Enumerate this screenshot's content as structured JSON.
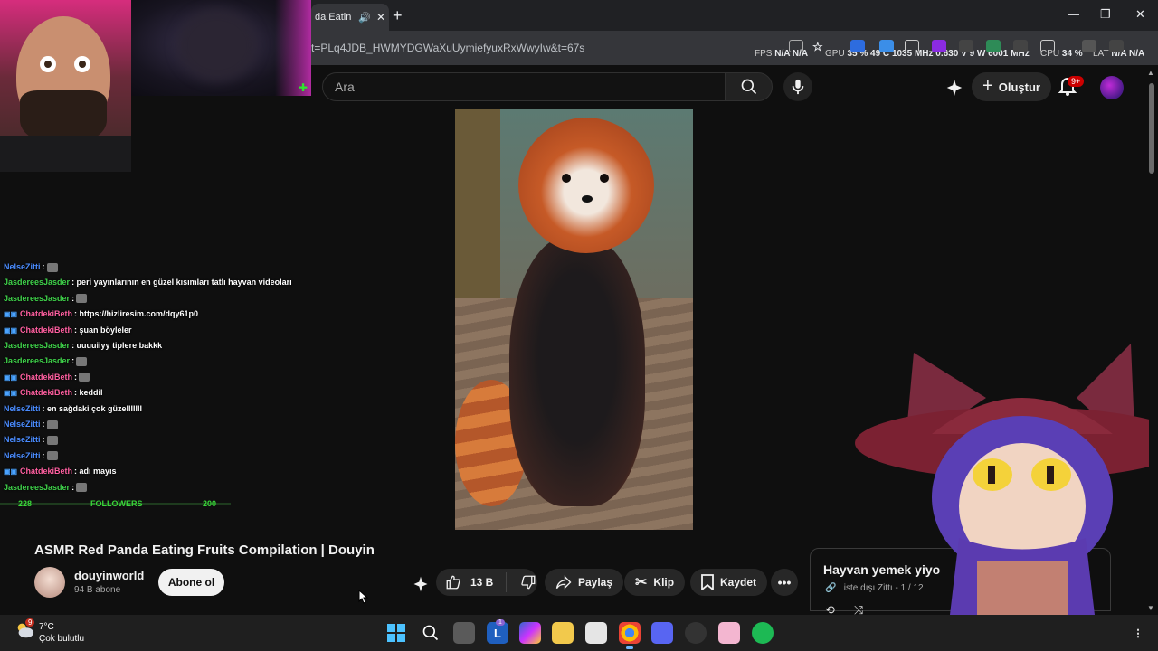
{
  "browser": {
    "tab_title": "da Eatin",
    "url": "t=PLq4JDB_HWMYDGWaXuUymiefyuxRxWwyIw&t=67s"
  },
  "hud": {
    "fps_label": "FPS",
    "fps": "N/A",
    "fps2": "N/A",
    "gpu_label": "GPU",
    "gpu_load": "35 %",
    "gpu_temp": "49 C",
    "gpu_clock": "1035 MHz",
    "gpu_volt": "0.630 V",
    "gpu_power": "9 W",
    "mem_clock": "6001 MHz",
    "cpu_label": "CPU",
    "cpu_load": "34 %",
    "lat_label": "LAT",
    "lat": "N/A",
    "lat2": "N/A"
  },
  "youtube": {
    "search_placeholder": "Ara",
    "create_label": "Oluştur",
    "notifications": "9+"
  },
  "chat": {
    "messages": [
      {
        "user": "NelseZitti",
        "text": ":",
        "color": "#4a8cff",
        "emote": true
      },
      {
        "user": "JasdereesJasder",
        "text": ": peri yayınlarının en güzel kısımları tatlı hayvan videoları",
        "color": "#3fd24a",
        "emote": false
      },
      {
        "user": "JasdereesJasder",
        "text": ":",
        "color": "#3fd24a",
        "emote": true
      },
      {
        "user": "ChatdekiBeth",
        "text": ": https://hizliresim.com/dqy61p0",
        "color": "#ff5fa0",
        "emote": false,
        "badges": true
      },
      {
        "user": "ChatdekiBeth",
        "text": ": şuan böyleler",
        "color": "#ff5fa0",
        "emote": false,
        "badges": true
      },
      {
        "user": "JasdereesJasder",
        "text": ": uuuuiiyy tiplere bakkk",
        "color": "#3fd24a",
        "emote": false
      },
      {
        "user": "JasdereesJasder",
        "text": ":",
        "color": "#3fd24a",
        "emote": true
      },
      {
        "user": "ChatdekiBeth",
        "text": ":",
        "color": "#ff5fa0",
        "emote": true,
        "badges": true
      },
      {
        "user": "ChatdekiBeth",
        "text": ": keddil",
        "color": "#ff5fa0",
        "emote": false,
        "badges": true
      },
      {
        "user": "NelseZitti",
        "text": ": en sağdaki çok güzelllllll",
        "color": "#4a8cff",
        "emote": false
      },
      {
        "user": "NelseZitti",
        "text": ":",
        "color": "#4a8cff",
        "emote": true
      },
      {
        "user": "NelseZitti",
        "text": ":",
        "color": "#4a8cff",
        "emote": true
      },
      {
        "user": "NelseZitti",
        "text": ":",
        "color": "#4a8cff",
        "emote": true
      },
      {
        "user": "ChatdekiBeth",
        "text": ": adı mayıs",
        "color": "#ff5fa0",
        "emote": false,
        "badges": true
      },
      {
        "user": "JasdereesJasder",
        "text": ":",
        "color": "#3fd24a",
        "emote": true
      }
    ],
    "followers_current": "228",
    "followers_label": "FOLLOWERS",
    "followers_goal": "200"
  },
  "video": {
    "title": "ASMR Red Panda Eating Fruits Compilation | Douyin",
    "channel": "douyinworld",
    "subscribers": "94 B abone",
    "subscribe_label": "Abone ol",
    "likes": "13 B",
    "share_label": "Paylaş",
    "clip_label": "Klip",
    "save_label": "Kaydet"
  },
  "playlist": {
    "title": "Hayvan yemek yiyo",
    "meta": "Liste dışı Zittı - 1 / 12"
  },
  "taskbar": {
    "temperature": "7°C",
    "condition": "Çok bulutlu",
    "weather_badge": "9",
    "app_badge": "1"
  }
}
